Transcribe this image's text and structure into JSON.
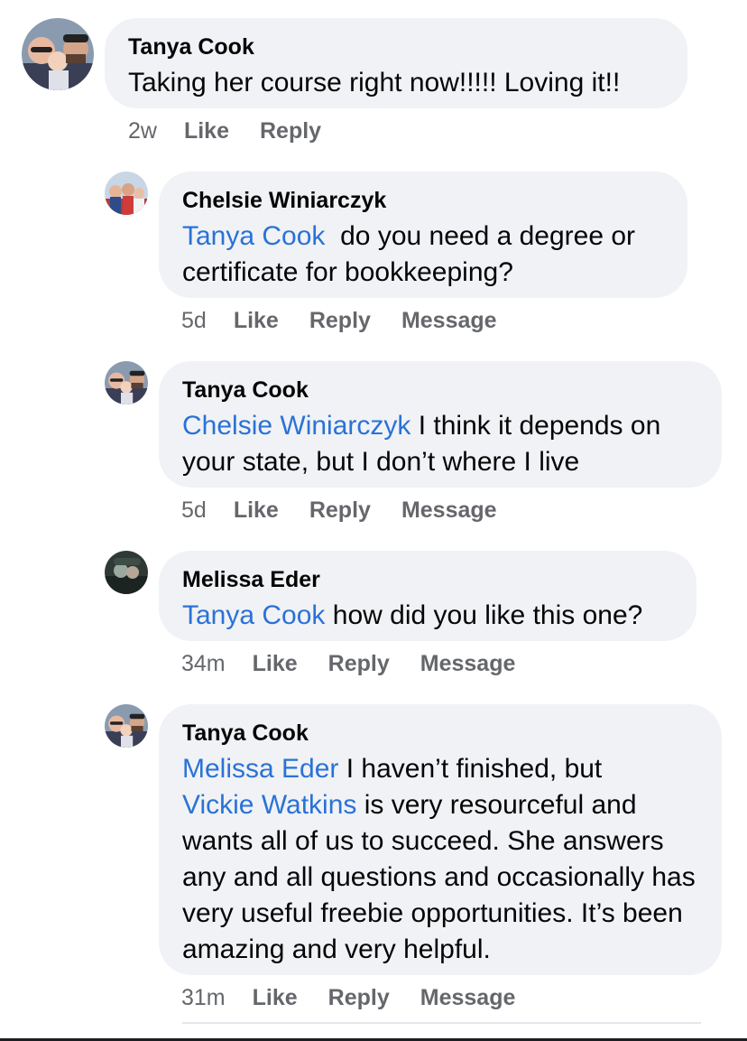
{
  "comments": [
    {
      "author": "Tanya Cook",
      "text": "Taking her course right now!!!!! Loving it!!",
      "time": "2w",
      "like": "Like",
      "reply": "Reply"
    },
    {
      "author": "Chelsie Winiarczyk",
      "mention": "Tanya Cook",
      "text": "do you need a degree or certificate for bookkeeping?",
      "time": "5d",
      "like": "Like",
      "reply": "Reply",
      "message": "Message"
    },
    {
      "author": "Tanya Cook",
      "mention": "Chelsie Winiarczyk",
      "text_a": "I think it depends on",
      "text_b": "your state, but I don’t where I live",
      "time": "5d",
      "like": "Like",
      "reply": "Reply",
      "message": "Message"
    },
    {
      "author": "Melissa Eder",
      "mention": "Tanya Cook",
      "text": "how did you like this one?",
      "time": "34m",
      "like": "Like",
      "reply": "Reply",
      "message": "Message"
    },
    {
      "author": "Tanya Cook",
      "mention": "Melissa Eder",
      "text_a": "I haven’t finished, but",
      "mention2": "Vickie Watkins",
      "text_b": "is very resourceful and wants all of us to succeed. She answers any and all questions and occasionally has very useful freebie opportunities. It’s been amazing and very helpful.",
      "time": "31m",
      "like": "Like",
      "reply": "Reply",
      "message": "Message"
    }
  ],
  "icons": {
    "avatar_tanya": "avatar-photo-couple-with-baby",
    "avatar_chelsie": "avatar-photo-group",
    "avatar_melissa": "avatar-photo-dark"
  },
  "colors": {
    "bubble": "#f0f2f5",
    "mention": "#2a72d6",
    "meta": "#65676b",
    "text": "#050505"
  }
}
